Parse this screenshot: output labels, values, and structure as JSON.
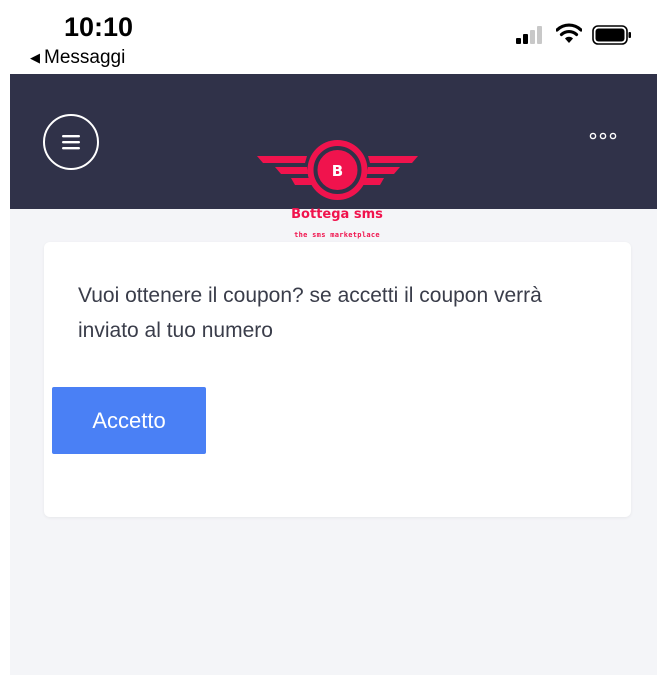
{
  "status_bar": {
    "time": "10:10",
    "back_label": "Messaggi",
    "icons": [
      "cellular-signal-icon",
      "wifi-icon",
      "battery-icon"
    ]
  },
  "header": {
    "background_color": "#303249",
    "menu_icon": "hamburger-menu-icon",
    "more_icon": "more-options-icon"
  },
  "brand": {
    "logo_letter": "B",
    "name": "Bottega sms",
    "tagline": "the sms marketplace",
    "color": "#f0134d"
  },
  "card": {
    "message": "Vuoi ottenere il coupon? se accetti il coupon verrà inviato al tuo numero",
    "accept_label": "Accetto",
    "accept_color": "#4a80f5"
  }
}
